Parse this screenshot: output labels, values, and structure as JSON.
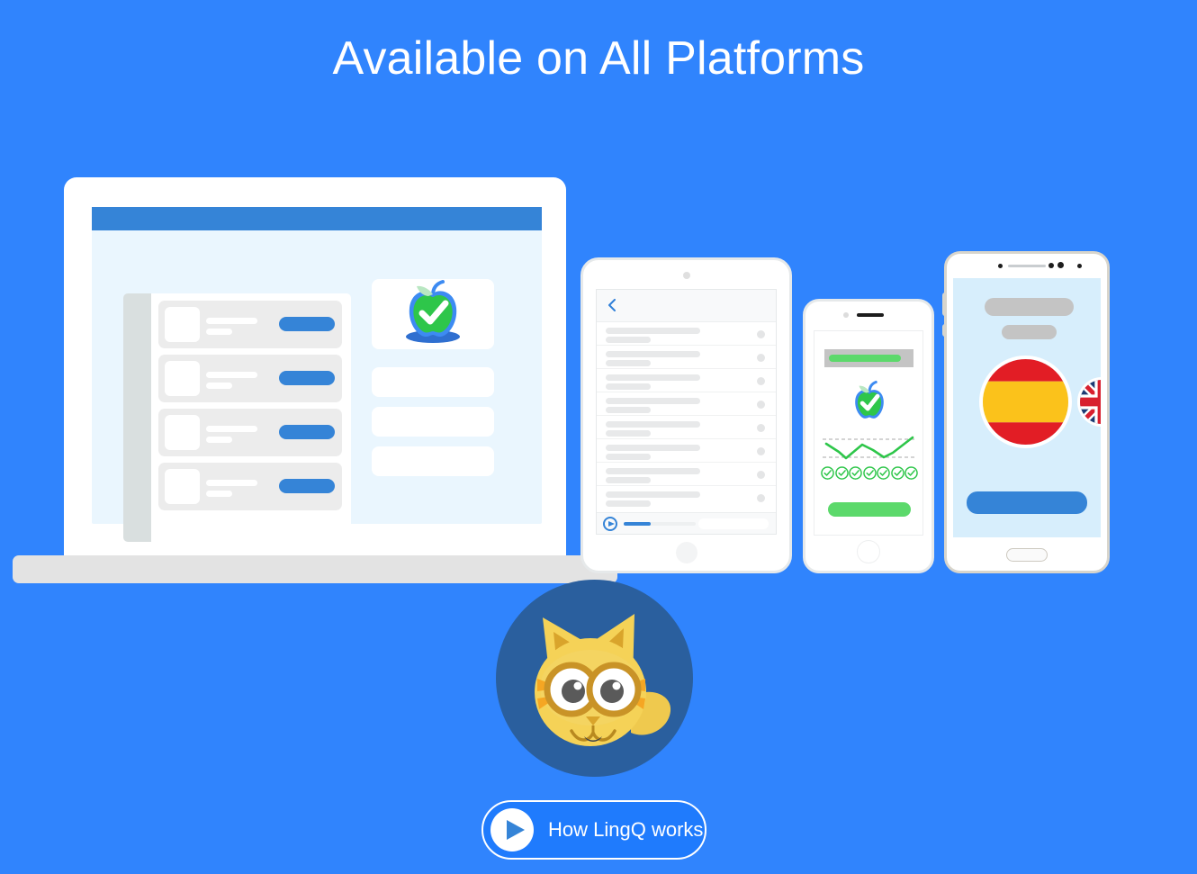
{
  "page": {
    "title": "Available on All Platforms",
    "background_color": "#3084fd"
  },
  "colors": {
    "background_blue": "#3084fd",
    "accent_blue": "#3584d7",
    "cta_blue": "#1f7bfd",
    "apple_green": "#2ec64a",
    "light_green": "#5cd96b",
    "screen_light_blue": "#eaf6fe",
    "android_screen_blue": "#d7eefc",
    "placeholder_gray": "#c4c4c4",
    "mascot_circle_blue": "#2a5f9e",
    "mascot_body_yellow": "#f5d257",
    "flag_spain_red": "#e21d25",
    "flag_spain_yellow": "#fbc21b",
    "flag_uk_blue": "#1b3a73",
    "flag_uk_red": "#d8202f"
  },
  "laptop": {
    "name": "laptop-device",
    "topbar_color": "#3584d7",
    "sidebar_present": true,
    "list_rows": [
      {
        "button_label": "",
        "line_1": "",
        "line_2": ""
      },
      {
        "button_label": "",
        "line_1": "",
        "line_2": ""
      },
      {
        "button_label": "",
        "line_1": "",
        "line_2": ""
      },
      {
        "button_label": "",
        "line_1": "",
        "line_2": ""
      }
    ],
    "feature_cards": [
      {
        "type": "apple-logo"
      },
      {
        "type": "placeholder"
      },
      {
        "type": "placeholder"
      },
      {
        "type": "placeholder"
      }
    ],
    "icons": {
      "logo": "lingq-apple-check-icon"
    }
  },
  "tablet": {
    "name": "tablet-device",
    "back_icon": "chevron-left-icon",
    "row_count": 8,
    "player": {
      "play_icon": "play-circle-icon",
      "progress_percent": 37
    }
  },
  "iphone": {
    "name": "iphone-device",
    "progress_bar": {
      "fill_percent": 80
    },
    "logo_icon": "lingq-apple-check-icon",
    "chart": {
      "gridlines": 2,
      "line_color": "#2ec64a"
    },
    "check_count": 7,
    "check_icon": "check-circle-icon",
    "button_color": "#5cd96b"
  },
  "android": {
    "name": "android-device",
    "placeholders": 2,
    "flags": [
      {
        "name": "spain-flag",
        "label": "Spanish"
      },
      {
        "name": "uk-flag",
        "label": "English"
      }
    ],
    "button_color": "#3584d7",
    "home_button": "android-home-button"
  },
  "mascot": {
    "name": "lingq-cat-mascot",
    "description": "cat-avatar"
  },
  "cta": {
    "label": "How LingQ works",
    "play_icon": "play-triangle-icon"
  },
  "chart_data": {
    "type": "line",
    "title": "",
    "xlabel": "",
    "ylabel": "",
    "x": [
      0,
      1,
      2,
      3,
      4,
      5
    ],
    "values": [
      72,
      40,
      26,
      70,
      34,
      96
    ],
    "ylim": [
      0,
      100
    ],
    "gridlines": [
      30,
      72
    ],
    "grid": true,
    "legend": "none",
    "series": [
      {
        "name": "progress",
        "values": [
          72,
          40,
          26,
          70,
          34,
          96
        ]
      }
    ]
  }
}
